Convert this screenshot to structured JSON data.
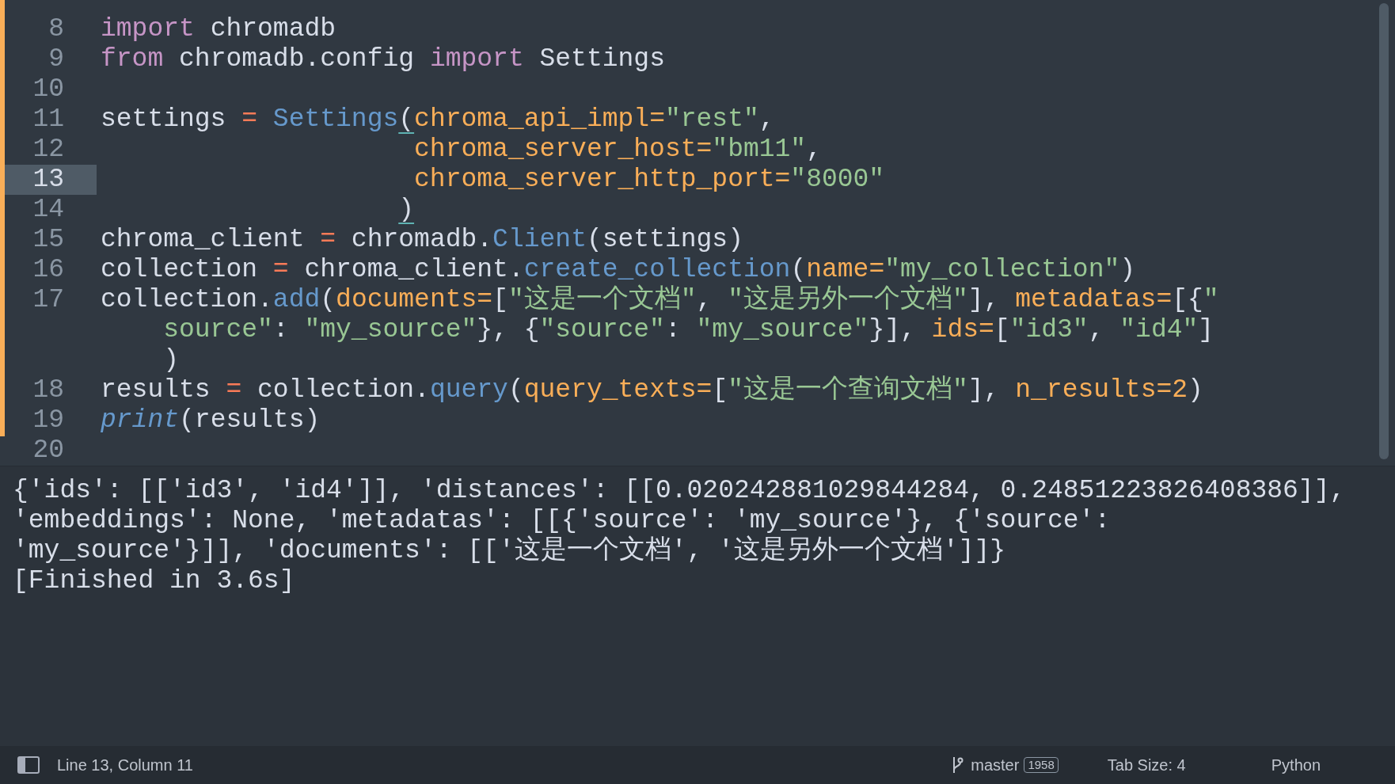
{
  "editor": {
    "lines": [
      {
        "number": "8",
        "selected": false,
        "rows": [
          [
            {
              "kind": "kw",
              "text": "import"
            },
            {
              "kind": "pl",
              "text": " chromadb"
            }
          ]
        ]
      },
      {
        "number": "9",
        "selected": false,
        "rows": [
          [
            {
              "kind": "kw",
              "text": "from"
            },
            {
              "kind": "pl",
              "text": " chromadb.config "
            },
            {
              "kind": "kw",
              "text": "import"
            },
            {
              "kind": "pl",
              "text": " Settings"
            }
          ]
        ]
      },
      {
        "number": "10",
        "selected": false,
        "rows": [
          []
        ]
      },
      {
        "number": "11",
        "selected": false,
        "rows": [
          [
            {
              "kind": "pl",
              "text": "settings "
            },
            {
              "kind": "op",
              "text": "= "
            },
            {
              "kind": "fn",
              "text": "Settings"
            },
            {
              "kind": "br",
              "text": "("
            },
            {
              "kind": "pa",
              "text": "chroma_api_impl="
            },
            {
              "kind": "st",
              "text": "\"rest\""
            },
            {
              "kind": "pl",
              "text": ","
            }
          ]
        ]
      },
      {
        "number": "12",
        "selected": false,
        "rows": [
          {
            "kind": "aligned",
            "tokens": [
              {
                "kind": "pa",
                "text": "chroma_server_host="
              },
              {
                "kind": "st",
                "text": "\"bm11\""
              },
              {
                "kind": "pl",
                "text": ","
              }
            ]
          }
        ]
      },
      {
        "number": "13",
        "selected": true,
        "rows": [
          {
            "kind": "aligned",
            "tokens": [
              {
                "kind": "pa",
                "text": "chroma_server_http_port="
              },
              {
                "kind": "st",
                "text": "\"8000\""
              }
            ]
          }
        ]
      },
      {
        "number": "14",
        "selected": false,
        "rows": [
          {
            "kind": "closing",
            "tokens": [
              {
                "kind": "br",
                "text": ")"
              }
            ]
          }
        ]
      },
      {
        "number": "15",
        "selected": false,
        "rows": [
          [
            {
              "kind": "pl",
              "text": "chroma_client "
            },
            {
              "kind": "op",
              "text": "="
            },
            {
              "kind": "pl",
              "text": " chromadb."
            },
            {
              "kind": "fn",
              "text": "Client"
            },
            {
              "kind": "pl",
              "text": "(settings)"
            }
          ]
        ]
      },
      {
        "number": "16",
        "selected": false,
        "rows": [
          [
            {
              "kind": "pl",
              "text": "collection "
            },
            {
              "kind": "op",
              "text": "="
            },
            {
              "kind": "pl",
              "text": " chroma_client."
            },
            {
              "kind": "fn",
              "text": "create_collection"
            },
            {
              "kind": "pl",
              "text": "("
            },
            {
              "kind": "pa",
              "text": "name="
            },
            {
              "kind": "st",
              "text": "\"my_collection\""
            },
            {
              "kind": "pl",
              "text": ")"
            }
          ]
        ]
      },
      {
        "number": "17",
        "selected": false,
        "rows": [
          {
            "tokens": [
              {
                "kind": "pl",
                "text": "collection."
              },
              {
                "kind": "fn",
                "text": "add"
              },
              {
                "kind": "pl",
                "text": "("
              },
              {
                "kind": "pa",
                "text": "documents="
              },
              {
                "kind": "pl",
                "text": "["
              },
              {
                "kind": "st",
                "text": "\"这是一个文档\""
              },
              {
                "kind": "pl",
                "text": ", "
              },
              {
                "kind": "st",
                "text": "\"这是另外一个文档\""
              },
              {
                "kind": "pl",
                "text": "], "
              },
              {
                "kind": "pa",
                "text": "metadatas="
              },
              {
                "kind": "pl",
                "text": "[{"
              },
              {
                "kind": "st",
                "text": "\""
              }
            ]
          },
          {
            "kind": "wrap",
            "tokens": [
              {
                "kind": "st",
                "text": "source\""
              },
              {
                "kind": "pl",
                "text": ": "
              },
              {
                "kind": "st",
                "text": "\"my_source\""
              },
              {
                "kind": "pl",
                "text": "}, {"
              },
              {
                "kind": "st",
                "text": "\"source\""
              },
              {
                "kind": "pl",
                "text": ": "
              },
              {
                "kind": "st",
                "text": "\"my_source\""
              },
              {
                "kind": "pl",
                "text": "}], "
              },
              {
                "kind": "pa",
                "text": "ids="
              },
              {
                "kind": "pl",
                "text": "["
              },
              {
                "kind": "st",
                "text": "\"id3\""
              },
              {
                "kind": "pl",
                "text": ", "
              },
              {
                "kind": "st",
                "text": "\"id4\""
              },
              {
                "kind": "pl",
                "text": "]"
              }
            ]
          },
          {
            "kind": "wrap",
            "tokens": [
              {
                "kind": "pl",
                "text": ")"
              }
            ]
          }
        ]
      },
      {
        "number": "18",
        "selected": false,
        "rows": [
          [
            {
              "kind": "pl",
              "text": "results "
            },
            {
              "kind": "op",
              "text": "="
            },
            {
              "kind": "pl",
              "text": " collection."
            },
            {
              "kind": "fn",
              "text": "query"
            },
            {
              "kind": "pl",
              "text": "("
            },
            {
              "kind": "pa",
              "text": "query_texts="
            },
            {
              "kind": "pl",
              "text": "["
            },
            {
              "kind": "st",
              "text": "\"这是一个查询文档\""
            },
            {
              "kind": "pl",
              "text": "], "
            },
            {
              "kind": "pa",
              "text": "n_results=2"
            },
            {
              "kind": "pl",
              "text": ")"
            }
          ]
        ]
      },
      {
        "number": "19",
        "selected": false,
        "rows": [
          [
            {
              "kind": "it",
              "text": "print"
            },
            {
              "kind": "pl",
              "text": "(results)"
            }
          ]
        ]
      },
      {
        "number": "20",
        "selected": false,
        "rows": [
          []
        ]
      }
    ]
  },
  "output": {
    "lines": [
      "{'ids': [['id3', 'id4']], 'distances': [[0.020242881029844284, 0.24851223826408386]],",
      "'embeddings': None, 'metadatas': [[{'source': 'my_source'}, {'source':",
      "'my_source'}]], 'documents': [['这是一个文档', '这是另外一个文档']]}",
      "[Finished in 3.6s]"
    ]
  },
  "status_bar": {
    "position": "Line 13, Column 11",
    "branch": "master",
    "branch_count": "1958",
    "tab_size": "Tab Size: 4",
    "syntax": "Python"
  }
}
